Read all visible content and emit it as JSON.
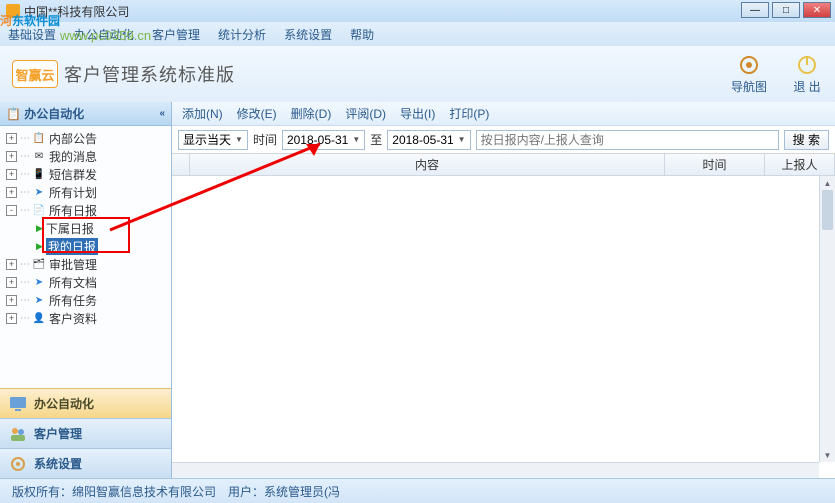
{
  "window": {
    "title": "中国**科技有限公司"
  },
  "menu": {
    "items": [
      "基础设置",
      "办公自动化",
      "客户管理",
      "统计分析",
      "系统设置",
      "帮助"
    ]
  },
  "watermark": {
    "line1_pre": "河",
    "line1_post": "东软件园",
    "line2": "www.pc0359.cn"
  },
  "brand": {
    "logo_text": "智赢云",
    "subtitle": "客户管理系统标准版",
    "nav_label": "导航图",
    "exit_label": "退 出"
  },
  "sidebar": {
    "header": "办公自动化",
    "tree": [
      {
        "expand": "+",
        "icon": "board",
        "label": "内部公告"
      },
      {
        "expand": "+",
        "icon": "mail",
        "label": "我的消息"
      },
      {
        "expand": "+",
        "icon": "sms",
        "label": "短信群发"
      },
      {
        "expand": "+",
        "icon": "plan",
        "label": "所有计划"
      },
      {
        "expand": "-",
        "icon": "report",
        "label": "所有日报",
        "children": [
          {
            "label": "下属日报"
          },
          {
            "label": "我的日报",
            "selected": true
          }
        ]
      },
      {
        "expand": "+",
        "icon": "approve",
        "label": "审批管理"
      },
      {
        "expand": "+",
        "icon": "doc",
        "label": "所有文档"
      },
      {
        "expand": "+",
        "icon": "task",
        "label": "所有任务"
      },
      {
        "expand": "+",
        "icon": "cust",
        "label": "客户资料"
      }
    ],
    "nav": [
      {
        "label": "办公自动化",
        "active": true
      },
      {
        "label": "客户管理",
        "active": false
      },
      {
        "label": "系统设置",
        "active": false
      }
    ]
  },
  "toolbar": {
    "items": [
      "添加(N)",
      "修改(E)",
      "删除(D)",
      "评阅(D)",
      "导出(I)",
      "打印(P)"
    ]
  },
  "filter": {
    "range_label": "显示当天",
    "time_label": "时间",
    "date_from": "2018-05-31",
    "to_label": "至",
    "date_to": "2018-05-31",
    "search_placeholder": "按日报内容/上报人查询",
    "search_btn": "搜 索"
  },
  "grid": {
    "columns": [
      "",
      "内容",
      "时间",
      "上报人"
    ]
  },
  "status": {
    "copyright": "版权所有：绵阳智赢信息技术有限公司",
    "user_prefix": "用户：",
    "user": "系统管理员(冯"
  }
}
